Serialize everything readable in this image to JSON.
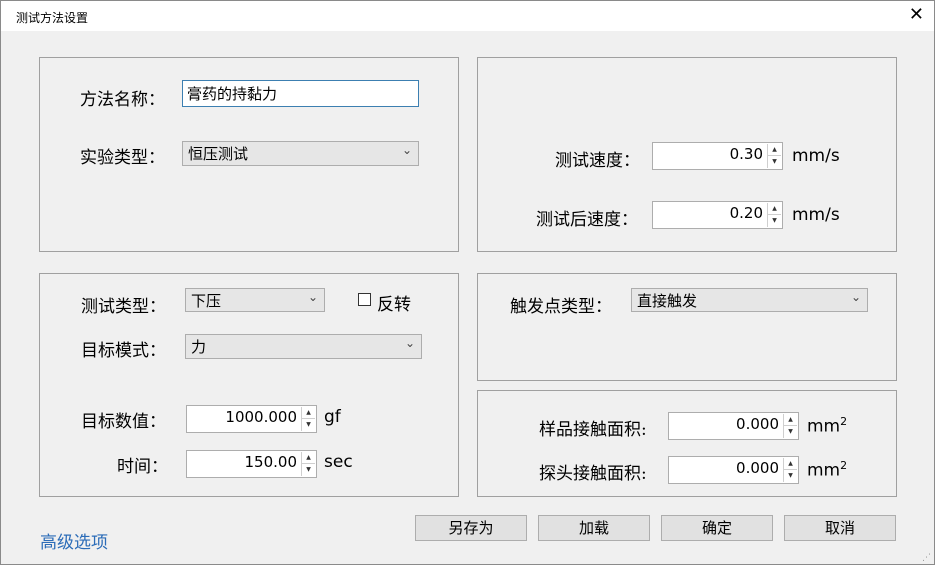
{
  "window": {
    "title": "测试方法设置",
    "close_icon": "close-icon"
  },
  "method": {
    "name_label": "方法名称：",
    "name_value": "膏药的持黏力",
    "type_label": "实验类型：",
    "type_value": "恒压测试"
  },
  "speed": {
    "test_speed_label": "测试速度：",
    "test_speed_value": "0.30",
    "test_speed_unit": "mm/s",
    "post_speed_label": "测试后速度：",
    "post_speed_value": "0.20",
    "post_speed_unit": "mm/s"
  },
  "test": {
    "mode_label": "测试类型：",
    "mode_value": "下压",
    "reverse_label": "反转",
    "reverse_checked": false,
    "target_mode_label": "目标模式：",
    "target_mode_value": "力",
    "target_value_label": "目标数值：",
    "target_value": "1000.000",
    "target_unit": "gf",
    "time_label": "时间：",
    "time_value": "150.00",
    "time_unit": "sec"
  },
  "trigger": {
    "label": "触发点类型：",
    "value": "直接触发"
  },
  "area": {
    "sample_label": "样品接触面积:",
    "sample_value": "0.000",
    "probe_label": "探头接触面积:",
    "probe_value": "0.000",
    "unit": "mm",
    "unit_exp": "2"
  },
  "footer": {
    "advanced_link": "高级选项",
    "save_as": "另存为",
    "load": "加载",
    "ok": "确定",
    "cancel": "取消"
  }
}
